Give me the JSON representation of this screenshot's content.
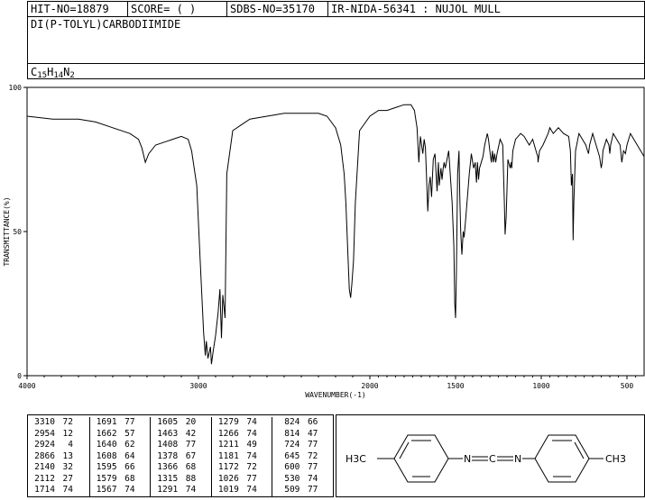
{
  "header": {
    "hit_no": "HIT-NO=18879",
    "score": "SCORE=  (   )",
    "sdbs_no": "SDBS-NO=35170",
    "ir_info": "IR-NIDA-56341 : NUJOL MULL"
  },
  "compound": {
    "name": "DI(P-TOLYL)CARBODIIMIDE",
    "formula_parts": [
      "C",
      "15",
      "H",
      "14",
      "N",
      "2"
    ]
  },
  "chart_data": {
    "type": "line",
    "ylabel": "TRANSMITTANCE(%)",
    "xlabel": "WAVENUMBER(-1)",
    "xlim": [
      4000,
      400
    ],
    "ylim": [
      0,
      100
    ],
    "x_ticks": [
      4000,
      3000,
      2000,
      1500,
      1000,
      500
    ],
    "y_ticks": [
      0,
      50,
      100
    ],
    "grid": false,
    "series": [
      {
        "x": [
          4000,
          3850,
          3700,
          3600,
          3500,
          3400,
          3350,
          3330,
          3310,
          3290,
          3250,
          3200,
          3150,
          3100,
          3060,
          3040,
          3010,
          2990,
          2970,
          2960,
          2954,
          2945,
          2930,
          2924,
          2915,
          2900,
          2885,
          2875,
          2866,
          2858,
          2845,
          2835,
          2800,
          2750,
          2700,
          2600,
          2500,
          2400,
          2300,
          2250,
          2200,
          2170,
          2150,
          2140,
          2130,
          2120,
          2112,
          2105,
          2095,
          2085,
          2060,
          2000,
          1950,
          1900,
          1850,
          1800,
          1760,
          1740,
          1725,
          1714,
          1705,
          1691,
          1683,
          1676,
          1670,
          1662,
          1655,
          1648,
          1640,
          1630,
          1620,
          1608,
          1600,
          1595,
          1585,
          1579,
          1572,
          1567,
          1560,
          1540,
          1520,
          1510,
          1505,
          1500,
          1495,
          1488,
          1480,
          1475,
          1470,
          1463,
          1455,
          1450,
          1440,
          1420,
          1408,
          1395,
          1385,
          1378,
          1372,
          1366,
          1360,
          1340,
          1330,
          1315,
          1308,
          1300,
          1291,
          1285,
          1279,
          1272,
          1266,
          1258,
          1240,
          1225,
          1215,
          1211,
          1205,
          1195,
          1181,
          1176,
          1172,
          1166,
          1150,
          1120,
          1100,
          1070,
          1050,
          1026,
          1020,
          1019,
          1010,
          990,
          960,
          950,
          930,
          900,
          870,
          840,
          830,
          824,
          818,
          814,
          810,
          800,
          780,
          760,
          740,
          730,
          724,
          718,
          700,
          680,
          660,
          650,
          645,
          640,
          620,
          605,
          600,
          595,
          580,
          560,
          540,
          530,
          520,
          509,
          500,
          480,
          460,
          440,
          420,
          400
        ],
        "y": [
          90,
          89,
          89,
          88,
          86,
          84,
          82,
          79,
          74,
          77,
          80,
          81,
          82,
          83,
          82,
          78,
          66,
          40,
          15,
          7,
          12,
          6,
          10,
          4,
          8,
          14,
          22,
          30,
          13,
          28,
          20,
          70,
          85,
          87,
          89,
          90,
          91,
          91,
          91,
          90,
          86,
          80,
          70,
          60,
          45,
          30,
          27,
          32,
          40,
          60,
          85,
          90,
          92,
          92,
          93,
          94,
          94,
          92,
          86,
          74,
          83,
          77,
          82,
          79,
          70,
          57,
          66,
          69,
          62,
          75,
          77,
          64,
          74,
          66,
          72,
          68,
          72,
          74,
          72,
          78,
          60,
          45,
          25,
          20,
          35,
          70,
          78,
          62,
          50,
          42,
          50,
          48,
          55,
          70,
          77,
          72,
          74,
          67,
          74,
          68,
          72,
          76,
          80,
          84,
          82,
          78,
          74,
          78,
          74,
          77,
          74,
          77,
          82,
          80,
          60,
          49,
          55,
          75,
          72,
          74,
          72,
          78,
          82,
          84,
          83,
          80,
          82,
          77,
          76,
          74,
          78,
          80,
          84,
          86,
          84,
          86,
          84,
          83,
          78,
          66,
          70,
          47,
          60,
          78,
          84,
          82,
          80,
          78,
          77,
          80,
          84,
          80,
          76,
          72,
          74,
          78,
          82,
          80,
          77,
          80,
          84,
          82,
          80,
          74,
          78,
          77,
          80,
          84,
          82,
          80,
          78,
          76
        ]
      }
    ]
  },
  "peak_table": {
    "columns": [
      [
        [
          "3310",
          "72"
        ],
        [
          "2954",
          "12"
        ],
        [
          "2924",
          "4"
        ],
        [
          "2866",
          "13"
        ],
        [
          "2140",
          "32"
        ],
        [
          "2112",
          "27"
        ],
        [
          "1714",
          "74"
        ]
      ],
      [
        [
          "1691",
          "77"
        ],
        [
          "1662",
          "57"
        ],
        [
          "1640",
          "62"
        ],
        [
          "1608",
          "64"
        ],
        [
          "1595",
          "66"
        ],
        [
          "1579",
          "68"
        ],
        [
          "1567",
          "74"
        ]
      ],
      [
        [
          "1605",
          "20"
        ],
        [
          "1463",
          "42"
        ],
        [
          "1408",
          "77"
        ],
        [
          "1378",
          "67"
        ],
        [
          "1366",
          "68"
        ],
        [
          "1315",
          "88"
        ],
        [
          "1291",
          "74"
        ]
      ],
      [
        [
          "1279",
          "74"
        ],
        [
          "1266",
          "74"
        ],
        [
          "1211",
          "49"
        ],
        [
          "1181",
          "74"
        ],
        [
          "1172",
          "72"
        ],
        [
          "1026",
          "77"
        ],
        [
          "1019",
          "74"
        ]
      ],
      [
        [
          "824",
          "66"
        ],
        [
          "814",
          "47"
        ],
        [
          "724",
          "77"
        ],
        [
          "645",
          "72"
        ],
        [
          "600",
          "77"
        ],
        [
          "530",
          "74"
        ],
        [
          "509",
          "77"
        ]
      ]
    ]
  },
  "structure": {
    "left_group": "H3C",
    "right_group": "CH3",
    "n1": "N",
    "c": "C",
    "n2": "N"
  }
}
